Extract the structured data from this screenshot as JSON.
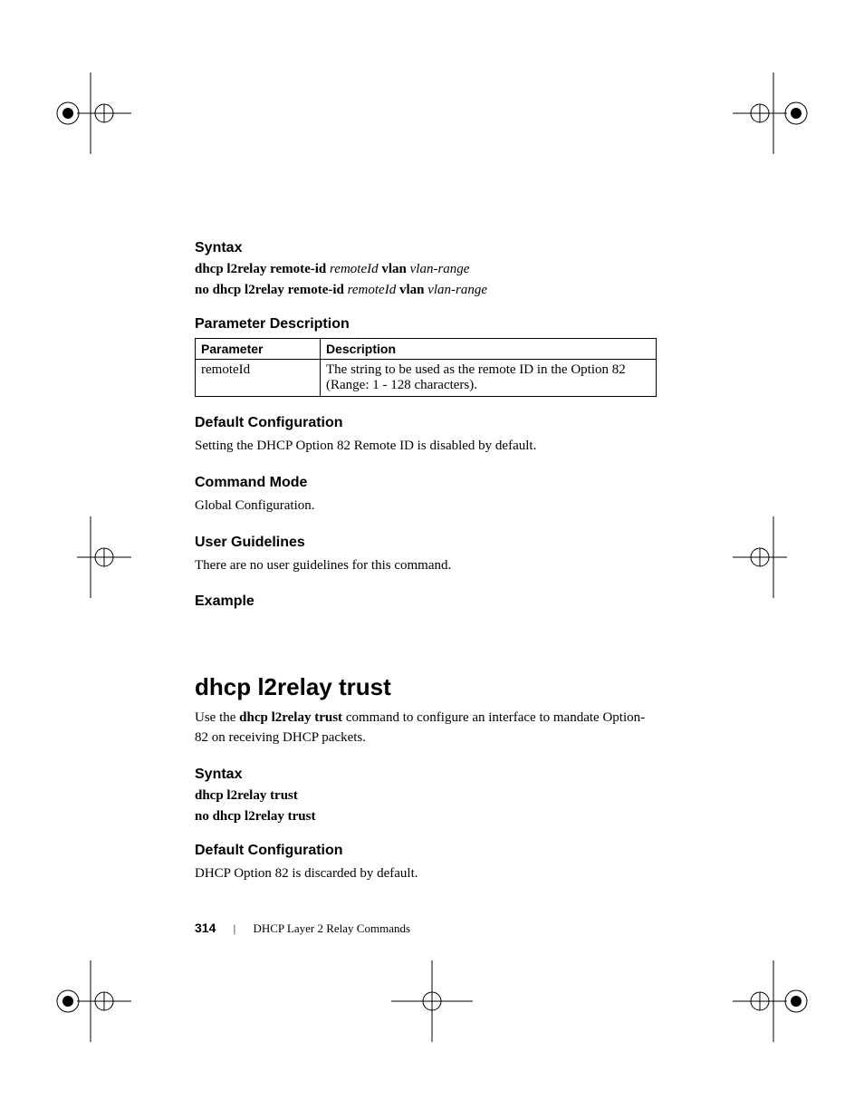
{
  "section1": {
    "syntax_heading": "Syntax",
    "syntax_line1_b1": "dhcp l2relay remote-id ",
    "syntax_line1_i1": "remoteId",
    "syntax_line1_b2": " vlan ",
    "syntax_line1_i2": "vlan-range",
    "syntax_line2_b1": "no dhcp l2relay remote-id ",
    "syntax_line2_i1": "remoteId",
    "syntax_line2_b2": " vlan ",
    "syntax_line2_i2": "vlan-range",
    "paramdesc_heading": "Parameter Description",
    "table": {
      "col1": "Parameter",
      "col2": "Description",
      "row1_param": "remoteId",
      "row1_desc": "The string to be used as the remote ID in the Option 82 (Range: 1 - 128 characters)."
    },
    "defaultcfg_heading": "Default Configuration",
    "defaultcfg_text": "Setting the DHCP Option 82 Remote ID is disabled by default.",
    "cmdmode_heading": "Command Mode",
    "cmdmode_text": "Global Configuration.",
    "userguide_heading": "User Guidelines",
    "userguide_text": "There are no user guidelines for this command.",
    "example_heading": "Example"
  },
  "section2": {
    "title": "dhcp l2relay trust",
    "intro_pre": "Use the ",
    "intro_bold": "dhcp l2relay trust",
    "intro_post": " command to configure an interface to mandate Option-82 on receiving DHCP packets.",
    "syntax_heading": "Syntax",
    "syntax_line1": "dhcp l2relay trust",
    "syntax_line2": "no dhcp l2relay trust",
    "defaultcfg_heading": "Default Configuration",
    "defaultcfg_text": "DHCP Option 82 is discarded by default."
  },
  "footer": {
    "page_number": "314",
    "separator": "|",
    "chapter": "DHCP Layer 2 Relay Commands"
  }
}
